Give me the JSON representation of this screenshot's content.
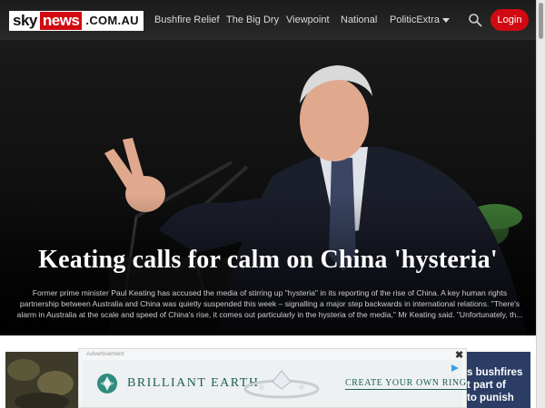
{
  "logo": {
    "sky": "sky",
    "news": "news",
    "domain": ".COM.AU"
  },
  "nav": {
    "items": [
      "Bushfire Relief",
      "The Big Dry",
      "Viewpoint",
      "National",
      "PoliticExtra"
    ],
    "login_label": "Login"
  },
  "hero": {
    "headline": "Keating calls for calm on China 'hysteria'",
    "summary": "Former prime minister Paul Keating has accused the media of stirring up \"hysteria\" in its reporting of the rise of China. A key human rights partnership between Australia and China was quietly suspended this week – signalling a major step backwards in international relations. \"There's alarm in Australia at the scale and speed of China's rise, it comes out particularly in the hysteria of the media,\" Mr Keating said. \"Unfortunately, th..."
  },
  "ad": {
    "label": "Advertisement",
    "close": "✖",
    "brand": "BRILLIANT EARTH",
    "cta": "CREATE YOUR OWN RING"
  },
  "side_story": {
    "line1": "s bushfires",
    "line2": "t part of",
    "line3": "to punish"
  },
  "colors": {
    "brand_red": "#d10a11",
    "nav_bg": "#1b1b1b",
    "ad_accent": "#1e5e58"
  },
  "icons": {
    "search": "search-icon",
    "caret": "chevron-down-icon",
    "ad_choices": "ad-choices-icon"
  }
}
